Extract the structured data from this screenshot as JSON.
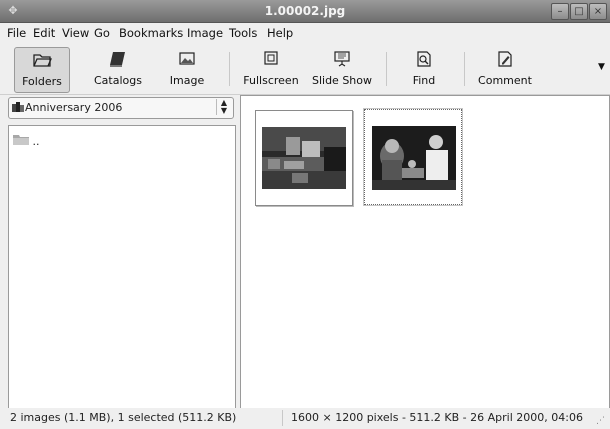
{
  "window": {
    "title": "1.00002.jpg",
    "minimize_glyph": "–",
    "maximize_glyph": "□",
    "close_glyph": "×"
  },
  "menu": {
    "file": "File",
    "edit": "Edit",
    "view": "View",
    "go": "Go",
    "bookmarks": "Bookmarks",
    "image": "Image",
    "tools": "Tools",
    "help": "Help"
  },
  "toolbar": {
    "folders": "Folders",
    "catalogs": "Catalogs",
    "image": "Image",
    "fullscreen": "Fullscreen",
    "slideshow": "Slide Show",
    "find": "Find",
    "comment": "Comment"
  },
  "location": {
    "selected": "Anniversary 2006"
  },
  "folders": {
    "items": [
      ".."
    ]
  },
  "thumbnails": {
    "count": 2,
    "selected_index": 1
  },
  "status": {
    "summary": "2 images (1.1 MB), 1 selected (511.2 KB)",
    "image_info": "1600 × 1200 pixels - 511.2 KB - 26 April 2000, 04:06"
  },
  "icons": {
    "app": "gthumb-icon",
    "folders": "folder-open-icon",
    "catalogs": "book-icon",
    "image": "picture-icon",
    "fullscreen": "fullscreen-icon",
    "slideshow": "projector-icon",
    "find": "find-icon",
    "comment": "note-icon"
  },
  "colors": {
    "titlebar": "#7f7f7f",
    "window_bg": "#efefef",
    "panel_bg": "#ffffff"
  }
}
